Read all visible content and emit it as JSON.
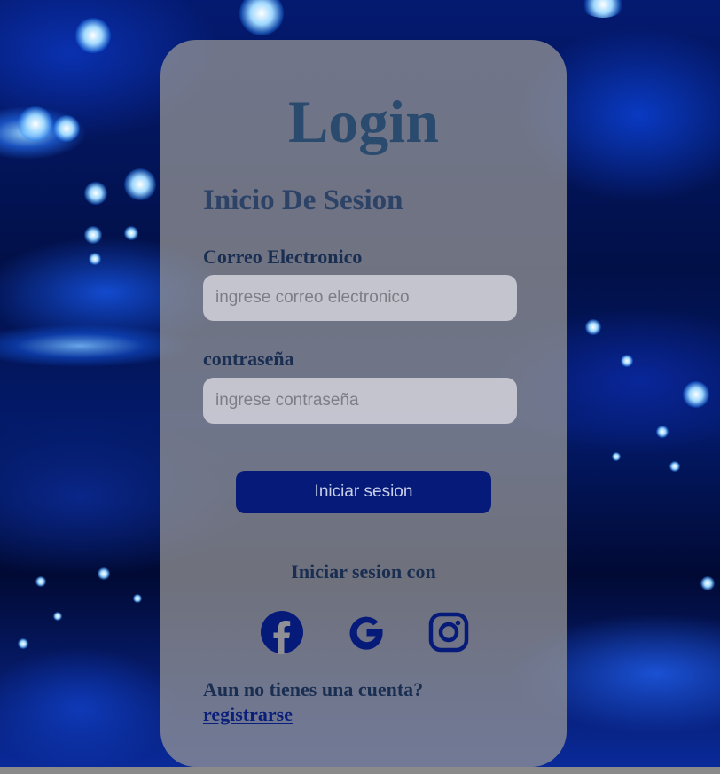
{
  "colors": {
    "card_background": "#969696",
    "title_color": "#2a4a6e",
    "label_color": "#1a2e52",
    "button_background": "#061a7a",
    "button_text": "#c9cfe6",
    "icon_color": "#061a7a",
    "link_color": "#0a1e7a"
  },
  "login": {
    "title": "Login",
    "subtitle": "Inicio De Sesion",
    "email_label": "Correo Electronico",
    "email_placeholder": "ingrese correo electronico",
    "password_label": "contraseña",
    "password_placeholder": "ingrese contraseña",
    "submit_label": "Iniciar sesion",
    "social_label": "Iniciar sesion con",
    "social_icons": [
      "facebook-icon",
      "google-icon",
      "instagram-icon"
    ],
    "no_account_text": "Aun no tienes una cuenta?",
    "register_link": "registrarse"
  }
}
